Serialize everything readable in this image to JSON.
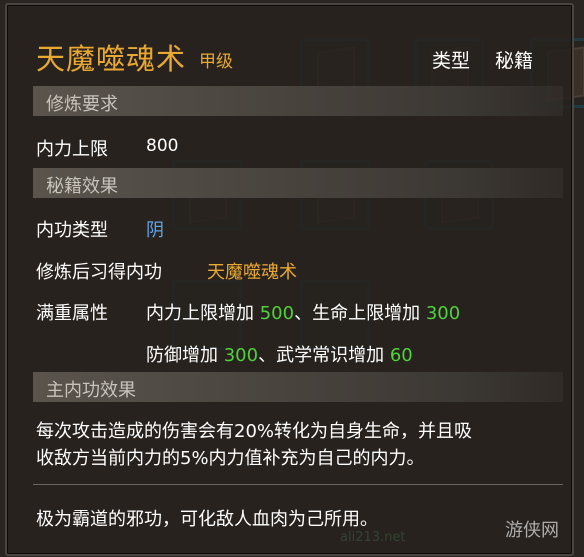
{
  "tooltip": {
    "title": "天魔噬魂术",
    "grade": "甲级",
    "type_label": "类型",
    "type_value": "秘籍",
    "section_requirements": "修炼要求",
    "inner_power_label": "内力上限",
    "inner_power_value": "800",
    "section_effects": "秘籍效果",
    "inner_type_label": "内功类型",
    "inner_type_value": "阴",
    "learn_label": "修炼后习得内功",
    "learn_value": "天魔噬魂术",
    "full_label": "满重属性",
    "full_line1_a": "内力上限增加",
    "full_line1_b": "500",
    "full_line1_c": "、生命上限增加",
    "full_line1_d": "300",
    "full_line2_a": "防御增加",
    "full_line2_b": "300",
    "full_line2_c": "、武学常识增加",
    "full_line2_d": "60",
    "section_main": "主内功效果",
    "main_desc_line1": "每次攻击造成的伤害会有20%转化为自身生命，并且吸",
    "main_desc_line2": "收敌方当前内力的5%内力值补充为自己的内力。",
    "flavor": "极为霸道的邪功，可化敌人血肉为己所用。"
  },
  "watermark": {
    "text": "游侠网",
    "url": "ali213.net"
  }
}
